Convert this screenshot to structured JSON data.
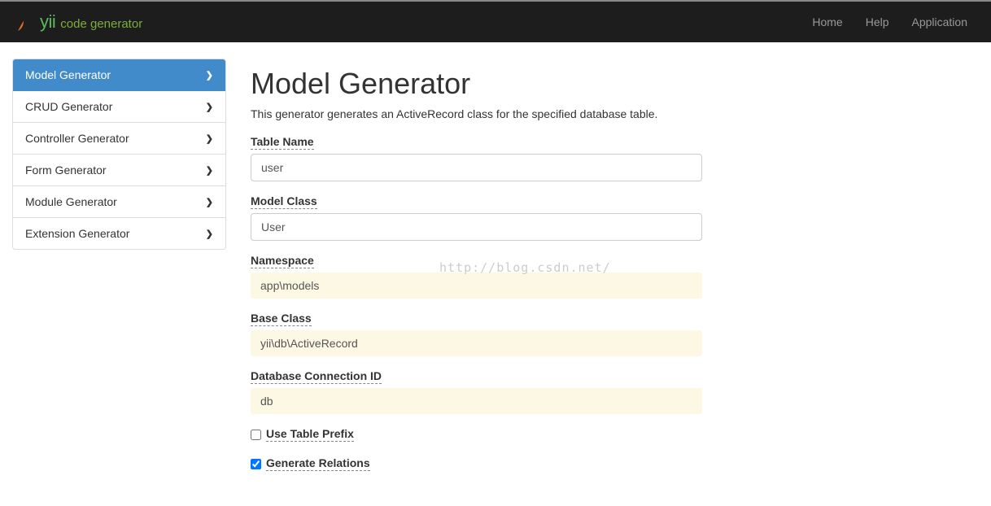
{
  "brand": {
    "yii": "yii",
    "sub": "code generator"
  },
  "nav": {
    "home": "Home",
    "help": "Help",
    "application": "Application"
  },
  "sidebar": {
    "items": [
      {
        "label": "Model Generator",
        "active": true
      },
      {
        "label": "CRUD Generator",
        "active": false
      },
      {
        "label": "Controller Generator",
        "active": false
      },
      {
        "label": "Form Generator",
        "active": false
      },
      {
        "label": "Module Generator",
        "active": false
      },
      {
        "label": "Extension Generator",
        "active": false
      }
    ]
  },
  "page": {
    "title": "Model Generator",
    "description": "This generator generates an ActiveRecord class for the specified database table."
  },
  "form": {
    "tableName": {
      "label": "Table Name",
      "value": "user"
    },
    "modelClass": {
      "label": "Model Class",
      "value": "User"
    },
    "namespace": {
      "label": "Namespace",
      "value": "app\\models"
    },
    "baseClass": {
      "label": "Base Class",
      "value": "yii\\db\\ActiveRecord"
    },
    "dbConnection": {
      "label": "Database Connection ID",
      "value": "db"
    },
    "useTablePrefix": {
      "label": "Use Table Prefix",
      "checked": false
    },
    "generateRelations": {
      "label": "Generate Relations",
      "checked": true
    }
  },
  "watermark": "http://blog.csdn.net/"
}
